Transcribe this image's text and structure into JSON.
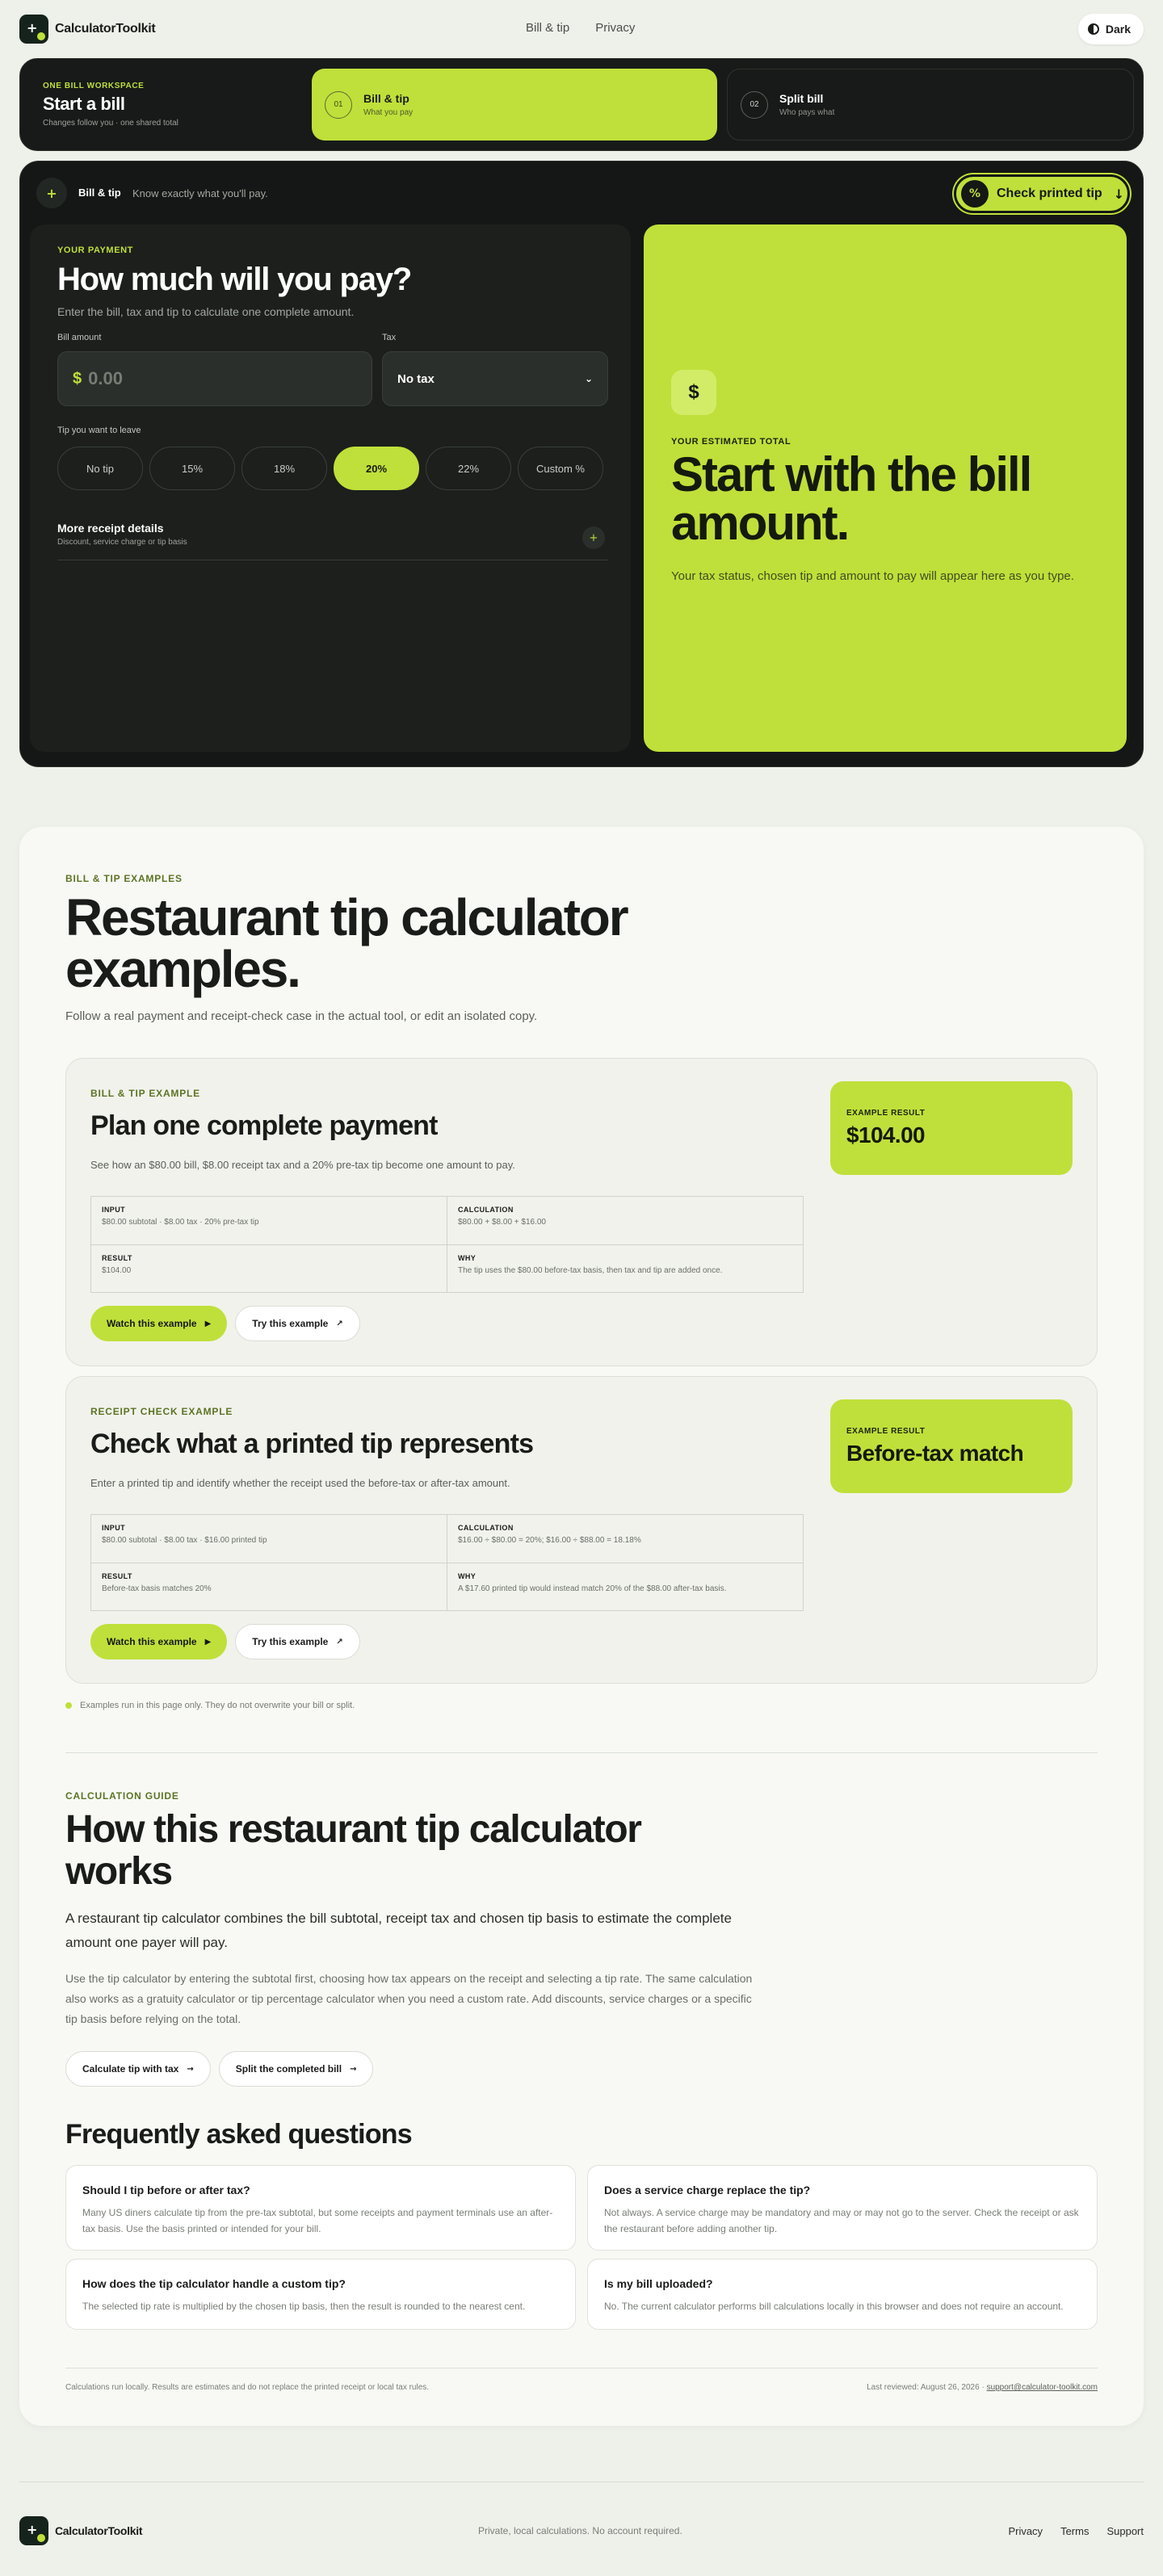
{
  "brand": {
    "name": "CalculatorToolkit"
  },
  "nav": {
    "items": [
      "Bill & tip",
      "Privacy"
    ]
  },
  "theme": {
    "label": "Dark"
  },
  "workspace": {
    "kicker": "ONE BILL WORKSPACE",
    "title": "Start a bill",
    "subtitle": "Changes follow you · one shared total",
    "tabs": [
      {
        "num": "01",
        "title": "Bill & tip",
        "sub": "What you pay"
      },
      {
        "num": "02",
        "title": "Split bill",
        "sub": "Who pays what"
      }
    ]
  },
  "calculator": {
    "header_title": "Bill & tip",
    "header_sub": "Know exactly what you'll pay.",
    "check_button": "Check printed tip",
    "kicker": "YOUR PAYMENT",
    "title": "How much will you pay?",
    "subtitle": "Enter the bill, tax and tip to calculate one complete amount.",
    "bill_label": "Bill amount",
    "currency": "$",
    "bill_placeholder": "0.00",
    "tax_label": "Tax",
    "tax_value": "No tax",
    "tip_label": "Tip you want to leave",
    "tip_options": [
      "No tip",
      "15%",
      "18%",
      "20%",
      "22%",
      "Custom %"
    ],
    "tip_selected": "20%",
    "more_title": "More receipt details",
    "more_sub": "Discount, service charge or tip basis",
    "result_icon": "$",
    "result_kicker": "YOUR ESTIMATED TOTAL",
    "result_title": "Start with the bill amount.",
    "result_sub": "Your tax status, chosen tip and amount to pay will appear here as you type."
  },
  "examples": {
    "kicker": "BILL & TIP EXAMPLES",
    "title": "Restaurant tip calculator examples.",
    "subtitle": "Follow a real payment and receipt-check case in the actual tool, or edit an isolated copy.",
    "items": [
      {
        "kicker": "BILL & TIP EXAMPLE",
        "title": "Plan one complete payment",
        "desc": "See how an $80.00 bill, $8.00 receipt tax and a 20% pre-tax tip become one amount to pay.",
        "input_h": "INPUT",
        "input": "$80.00 subtotal · $8.00 tax · 20% pre-tax tip",
        "calc_h": "CALCULATION",
        "calc": "$80.00 + $8.00 + $16.00",
        "result_h": "RESULT",
        "result": "$104.00",
        "why_h": "WHY",
        "why": "The tip uses the $80.00 before-tax basis, then tax and tip are added once.",
        "watch": "Watch this example",
        "try": "Try this example",
        "result_kicker": "EXAMPLE RESULT",
        "result_value": "$104.00"
      },
      {
        "kicker": "RECEIPT CHECK EXAMPLE",
        "title": "Check what a printed tip represents",
        "desc": "Enter a printed tip and identify whether the receipt used the before-tax or after-tax amount.",
        "input_h": "INPUT",
        "input": "$80.00 subtotal · $8.00 tax · $16.00 printed tip",
        "calc_h": "CALCULATION",
        "calc": "$16.00 ÷ $80.00 = 20%; $16.00 ÷ $88.00 = 18.18%",
        "result_h": "RESULT",
        "result": "Before-tax basis matches 20%",
        "why_h": "WHY",
        "why": "A $17.60 printed tip would instead match 20% of the $88.00 after-tax basis.",
        "watch": "Watch this example",
        "try": "Try this example",
        "result_kicker": "EXAMPLE RESULT",
        "result_value": "Before-tax match"
      }
    ],
    "note": "Examples run in this page only. They do not overwrite your bill or split."
  },
  "guide": {
    "kicker": "CALCULATION GUIDE",
    "title": "How this restaurant tip calculator works",
    "lead": "A restaurant tip calculator combines the bill subtotal, receipt tax and chosen tip basis to estimate the complete amount one payer will pay.",
    "body": "Use the tip calculator by entering the subtotal first, choosing how tax appears on the receipt and selecting a tip rate. The same calculation also works as a gratuity calculator or tip percentage calculator when you need a custom rate. Add discounts, service charges or a specific tip basis before relying on the total.",
    "btn1": "Calculate tip with tax",
    "btn2": "Split the completed bill"
  },
  "faq": {
    "title": "Frequently asked questions",
    "items": [
      {
        "q": "Should I tip before or after tax?",
        "a": "Many US diners calculate tip from the pre-tax subtotal, but some receipts and payment terminals use an after-tax basis. Use the basis printed or intended for your bill."
      },
      {
        "q": "Does a service charge replace the tip?",
        "a": "Not always. A service charge may be mandatory and may or may not go to the server. Check the receipt or ask the restaurant before adding another tip."
      },
      {
        "q": "How does the tip calculator handle a custom tip?",
        "a": "The selected tip rate is multiplied by the chosen tip basis, then the result is rounded to the nearest cent."
      },
      {
        "q": "Is my bill uploaded?",
        "a": "No. The current calculator performs bill calculations locally in this browser and does not require an account."
      }
    ]
  },
  "fine": {
    "left": "Calculations run locally. Results are estimates and do not replace the printed receipt or local tax rules.",
    "reviewed": "Last reviewed: August 26, 2026 ·",
    "email": "support@calculator-toolkit.com"
  },
  "footer": {
    "center": "Private, local calculations. No account required.",
    "links": [
      "Privacy",
      "Terms",
      "Support"
    ]
  },
  "colors": {
    "accent": "#bfe03a",
    "dark": "#141715",
    "page": "#eef0ea"
  }
}
